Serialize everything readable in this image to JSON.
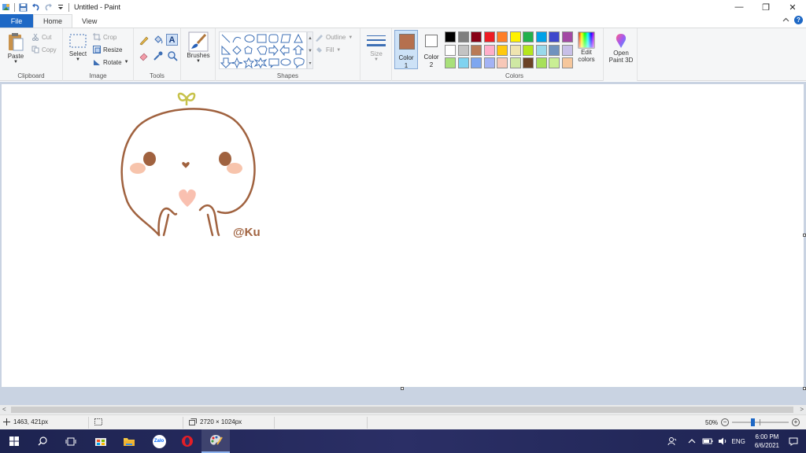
{
  "window": {
    "title": "Untitled - Paint",
    "controls": {
      "minimize": "—",
      "restore": "❐",
      "close": "✕"
    }
  },
  "tabs": {
    "file": "File",
    "home": "Home",
    "view": "View"
  },
  "ribbon": {
    "clipboard": {
      "label": "Clipboard",
      "paste": "Paste",
      "cut": "Cut",
      "copy": "Copy"
    },
    "image": {
      "label": "Image",
      "select": "Select",
      "crop": "Crop",
      "resize": "Resize",
      "rotate": "Rotate"
    },
    "tools": {
      "label": "Tools"
    },
    "brushes": {
      "label": "Brushes"
    },
    "shapes": {
      "label": "Shapes",
      "outline": "Outline",
      "fill": "Fill"
    },
    "size": {
      "label": "Size"
    },
    "colors": {
      "label": "Colors",
      "color1_label": "Color",
      "color1_num": "1",
      "color2_label": "Color",
      "color2_num": "2",
      "color1": "#b5704e",
      "color2": "#ffffff",
      "edit": "Edit",
      "edit2": "colors",
      "row1": [
        "#000000",
        "#7f7f7f",
        "#880015",
        "#ed1c24",
        "#ff7f27",
        "#fff200",
        "#22b14c",
        "#00a2e8",
        "#3f48cc",
        "#a349a4"
      ],
      "row2": [
        "#ffffff",
        "#c3c3c3",
        "#b97a57",
        "#ffaec9",
        "#ffc90e",
        "#efe4b0",
        "#b5e61d",
        "#99d9ea",
        "#7092be",
        "#c8bfe7"
      ],
      "row3": [
        "#a8e07a",
        "#7fd3f0",
        "#7ea7f0",
        "#a3b3f5",
        "#f7c8b8",
        "#cfe8a3",
        "#6b4226",
        "#a7e05a",
        "#c9ee94",
        "#f6c79c"
      ]
    },
    "paint3d": {
      "line1": "Open",
      "line2": "Paint 3D"
    }
  },
  "drawing": {
    "signature": "@Ku",
    "stroke": "#a0623f",
    "blush": "#f7c4ac",
    "heart": "#f9c0b0",
    "eyes": "#a0623f",
    "sprout": "#c7c24a"
  },
  "status": {
    "cursor_pos": "1463, 421px",
    "image_size": "2720 × 1024px",
    "zoom": "50%"
  },
  "taskbar": {
    "lang": "ENG",
    "time": "6:00 PM",
    "date": "6/6/2021",
    "zalo": "Zalo"
  }
}
